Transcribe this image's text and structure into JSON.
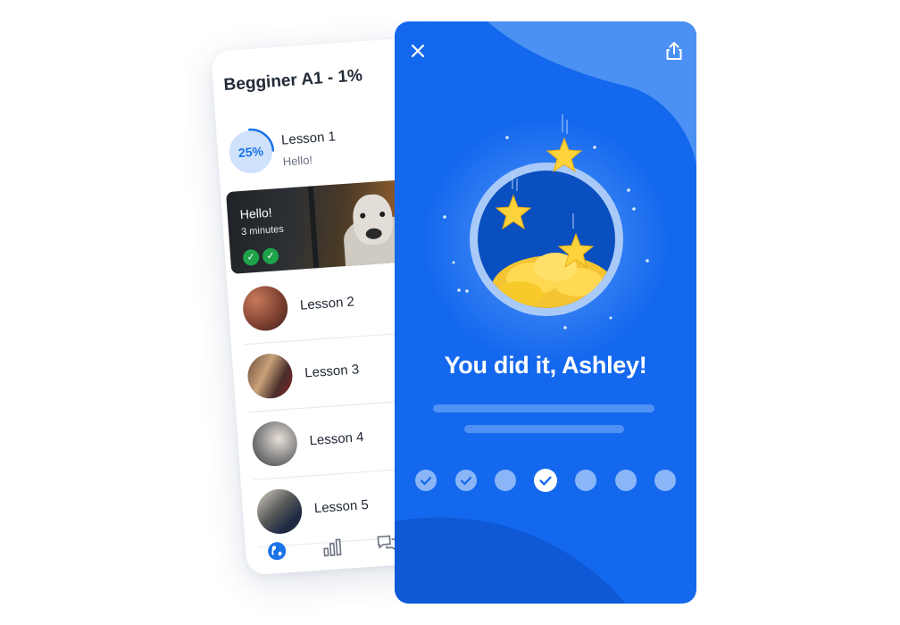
{
  "course": {
    "title": "Begginer A1 - 1%",
    "current_lesson": {
      "progress": 0.25,
      "progress_label": "25%",
      "name": "Lesson 1",
      "subtitle": "Hello!"
    },
    "video": {
      "title": "Hello!",
      "duration": "3 minutes",
      "completed_checks": 2
    },
    "lessons": [
      {
        "name": "Lesson 2",
        "thumb": "street-photo"
      },
      {
        "name": "Lesson 3",
        "thumb": "crowd-photo"
      },
      {
        "name": "Lesson 4",
        "thumb": "people-photo"
      },
      {
        "name": "Lesson 5",
        "thumb": "friends-photo"
      }
    ],
    "tabs": [
      {
        "icon": "globe-icon",
        "active": true
      },
      {
        "icon": "stats-icon",
        "active": false
      },
      {
        "icon": "chat-icon",
        "active": false
      }
    ]
  },
  "success": {
    "title": "You did it, Ashley!",
    "close_icon": "close-icon",
    "share_icon": "share-icon",
    "steps": [
      {
        "state": "done"
      },
      {
        "state": "done"
      },
      {
        "state": "pending"
      },
      {
        "state": "current"
      },
      {
        "state": "pending"
      },
      {
        "state": "pending"
      },
      {
        "state": "pending"
      }
    ]
  },
  "colors": {
    "brand_blue": "#1468EE",
    "accent_blue": "#1A73E8",
    "success_green": "#1EA34A",
    "star_yellow": "#F7C92B"
  }
}
